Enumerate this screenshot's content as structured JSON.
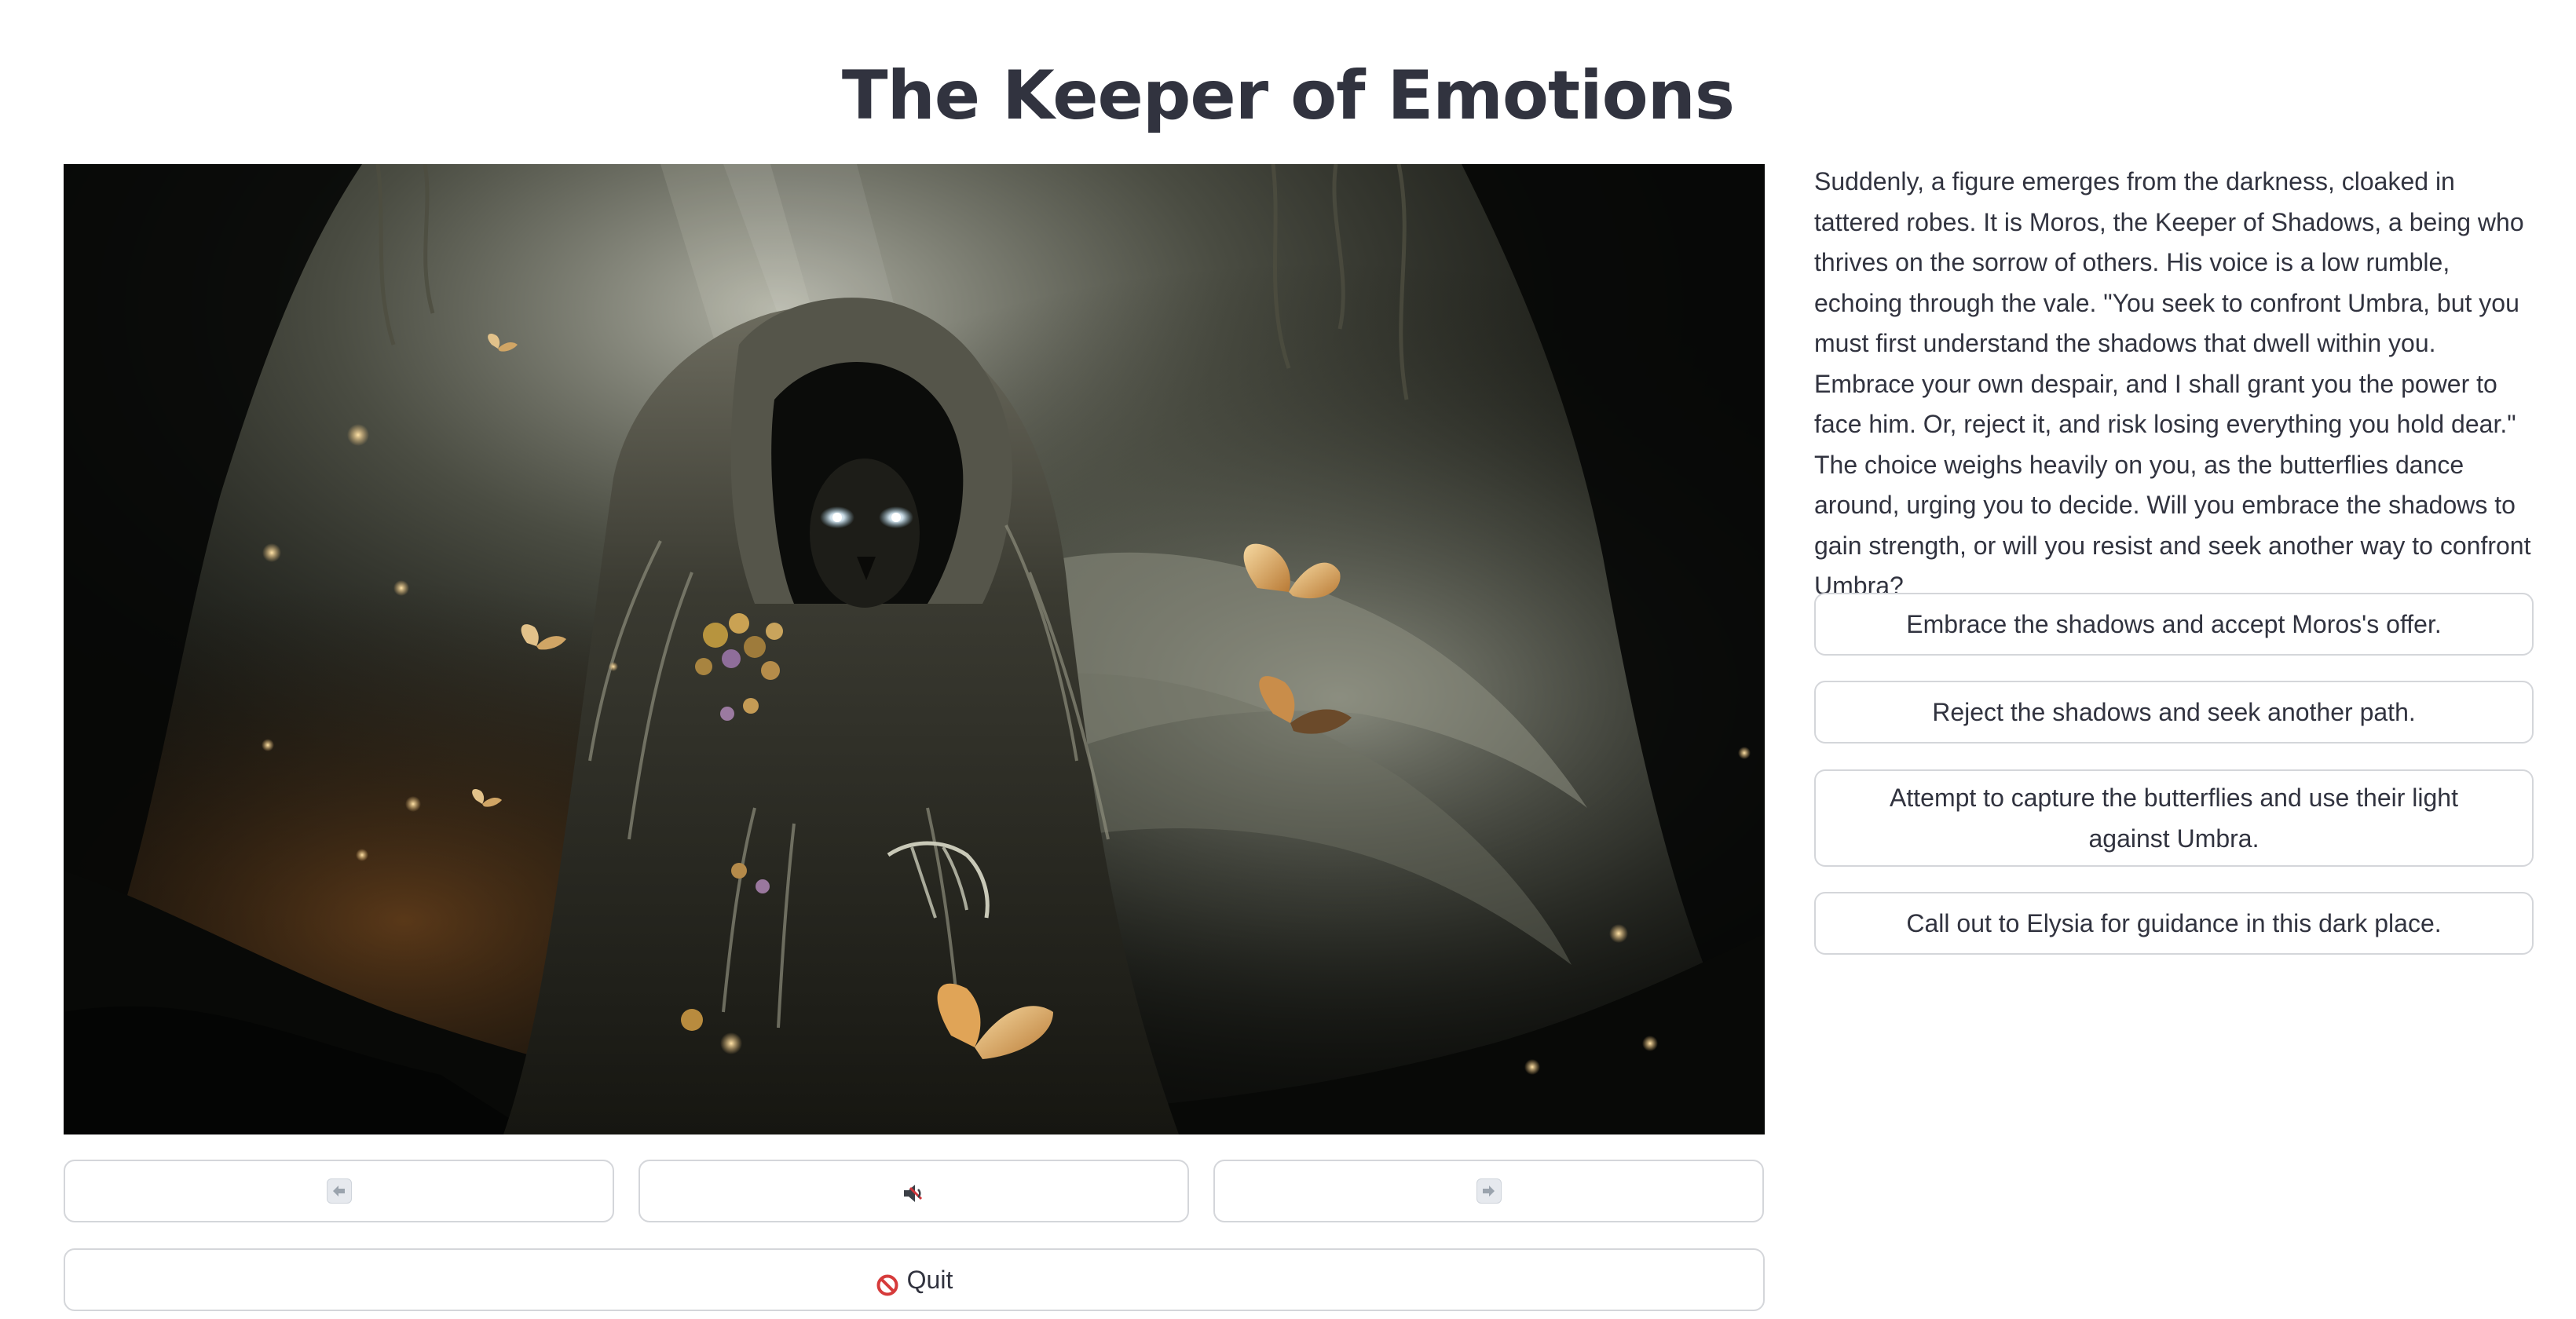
{
  "app": {
    "title": "The Keeper of Emotions"
  },
  "scene": {
    "image_icon": "hooded-keeper-illustration",
    "palette": {
      "background": "#0b0c0a",
      "mist": "#c9c8b6",
      "butterfly": "#e8b978",
      "glow": "#f2c47a"
    }
  },
  "story": {
    "text": "Suddenly, a figure emerges from the darkness, cloaked in tattered robes. It is Moros, the Keeper of Shadows, a being who thrives on the sorrow of others. His voice is a low rumble, echoing through the vale. \"You seek to confront Umbra, but you must first understand the shadows that dwell within you. Embrace your own despair, and I shall grant you the power to face him. Or, reject it, and risk losing everything you hold dear.\" The choice weighs heavily on you, as the butterflies dance around, urging you to decide. Will you embrace the shadows to gain strength, or will you resist and seek another way to confront Umbra?"
  },
  "choices": [
    {
      "label": "Embrace the shadows and accept Moros's offer."
    },
    {
      "label": "Reject the shadows and seek another path."
    },
    {
      "label": "Attempt to capture the butterflies and use their light against Umbra."
    },
    {
      "label": "Call out to Elysia for guidance in this dark place."
    }
  ],
  "controls": {
    "back_icon": "left-arrow-icon",
    "mute_icon": "muted-speaker-icon",
    "forward_icon": "right-arrow-icon",
    "quit_icon": "prohibited-icon",
    "quit_label": "Quit"
  },
  "colors": {
    "text": "#31333f",
    "border": "#d4d6da",
    "background": "#ffffff"
  }
}
